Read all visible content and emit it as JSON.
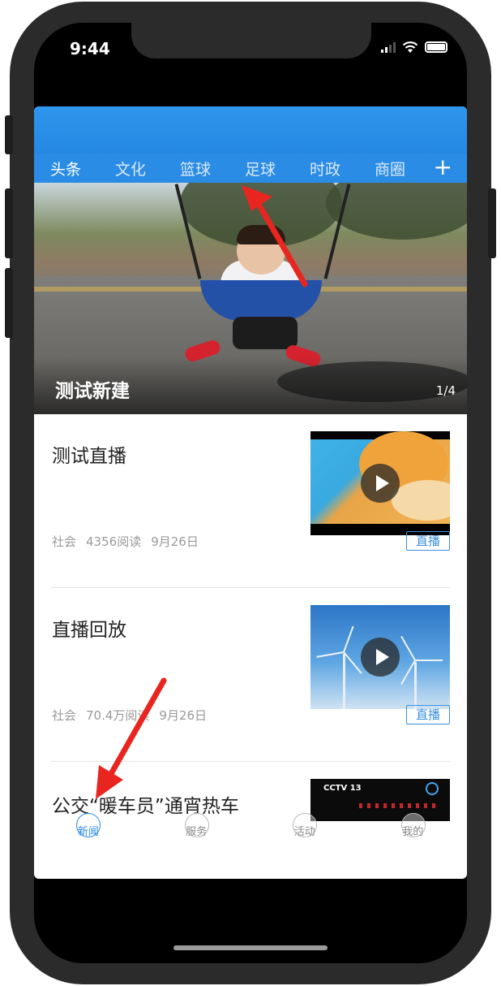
{
  "status_bar": {
    "time": "9:44"
  },
  "tabs": {
    "items": [
      "头条",
      "文化",
      "篮球",
      "足球",
      "时政",
      "商圈"
    ],
    "active_index": 0,
    "add_label": "+"
  },
  "banner": {
    "title": "测试新建",
    "page_indicator": "1/4"
  },
  "news": [
    {
      "title": "测试直播",
      "category": "社会",
      "reads": "4356阅读",
      "date": "9月26日",
      "badge": "直播"
    },
    {
      "title": "直播回放",
      "category": "社会",
      "reads": "70.4万阅读",
      "date": "9月26日",
      "badge": "直播"
    }
  ],
  "partial_item": {
    "title": "公交“暖车员”通宵热车",
    "thumb_logo": "CCTV 13"
  },
  "bottom_nav": {
    "items": [
      "新闻",
      "服务",
      "活动",
      "我的"
    ],
    "active_index": 0
  },
  "colors": {
    "accent": "#2a8ce4",
    "tab_indicator": "#f5a623",
    "arrow": "#e8261f"
  },
  "icons": [
    "signal-icon",
    "wifi-icon",
    "battery-icon",
    "add-icon",
    "play-icon"
  ]
}
